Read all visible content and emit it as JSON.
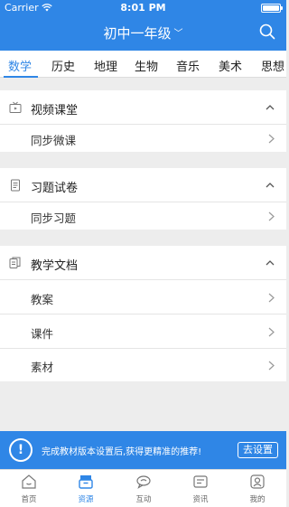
{
  "status_bar": {
    "carrier": "Carrier",
    "time": "8:01 PM"
  },
  "header": {
    "grade": "初中一年级",
    "chevron": "﹀"
  },
  "subjects": [
    "数学",
    "历史",
    "地理",
    "生物",
    "音乐",
    "美术",
    "思想"
  ],
  "active_subject": "数学",
  "sections": [
    {
      "title": "视频课堂",
      "icon": "tv-icon",
      "items": [
        "同步微课"
      ]
    },
    {
      "title": "习题试卷",
      "icon": "document-icon",
      "items": [
        "同步习题"
      ]
    },
    {
      "title": "教学文档",
      "icon": "files-icon",
      "items": [
        "教案",
        "课件",
        "素材"
      ]
    }
  ],
  "banner": {
    "text": "完成教材版本设置后,获得更精准的推荐!",
    "button": "去设置"
  },
  "tab_bar": [
    {
      "label": "首页",
      "icon": "home-icon"
    },
    {
      "label": "资源",
      "icon": "resources-icon"
    },
    {
      "label": "互动",
      "icon": "interact-icon"
    },
    {
      "label": "资讯",
      "icon": "news-icon"
    },
    {
      "label": "我的",
      "icon": "profile-icon"
    }
  ],
  "colors": {
    "accent": "#2f86e6",
    "background": "#ededed"
  }
}
